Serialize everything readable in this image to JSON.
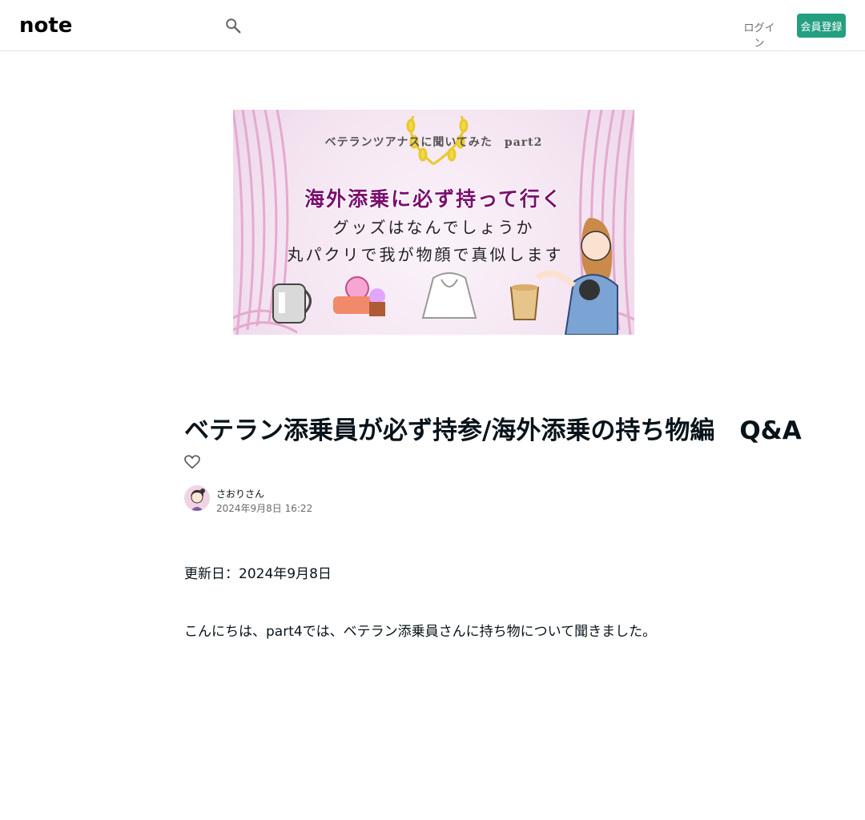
{
  "header": {
    "logo_text": "note",
    "login_label": "ログイン",
    "signup_label": "会員登録"
  },
  "hero": {
    "subtitle": "ベテランツアナスに聞いてみた　part2",
    "title": "海外添乗に必ず持って行く",
    "line1": "グッズはなんでしょうか",
    "line2": "丸パクリで我が物顔で真似します"
  },
  "article": {
    "title": "ベテラン添乗員が必ず持参/海外添乗の持ち物編　Q&A",
    "author": "さおりさん",
    "date": "2024年9月8日 16:22",
    "body": [
      "更新日：2024年9月8日",
      "こんにちは、part4では、ベテラン添乗員さんに持ち物について聞きました。"
    ]
  },
  "colors": {
    "accent": "#249f80",
    "hero_title": "#7a0f6f"
  }
}
